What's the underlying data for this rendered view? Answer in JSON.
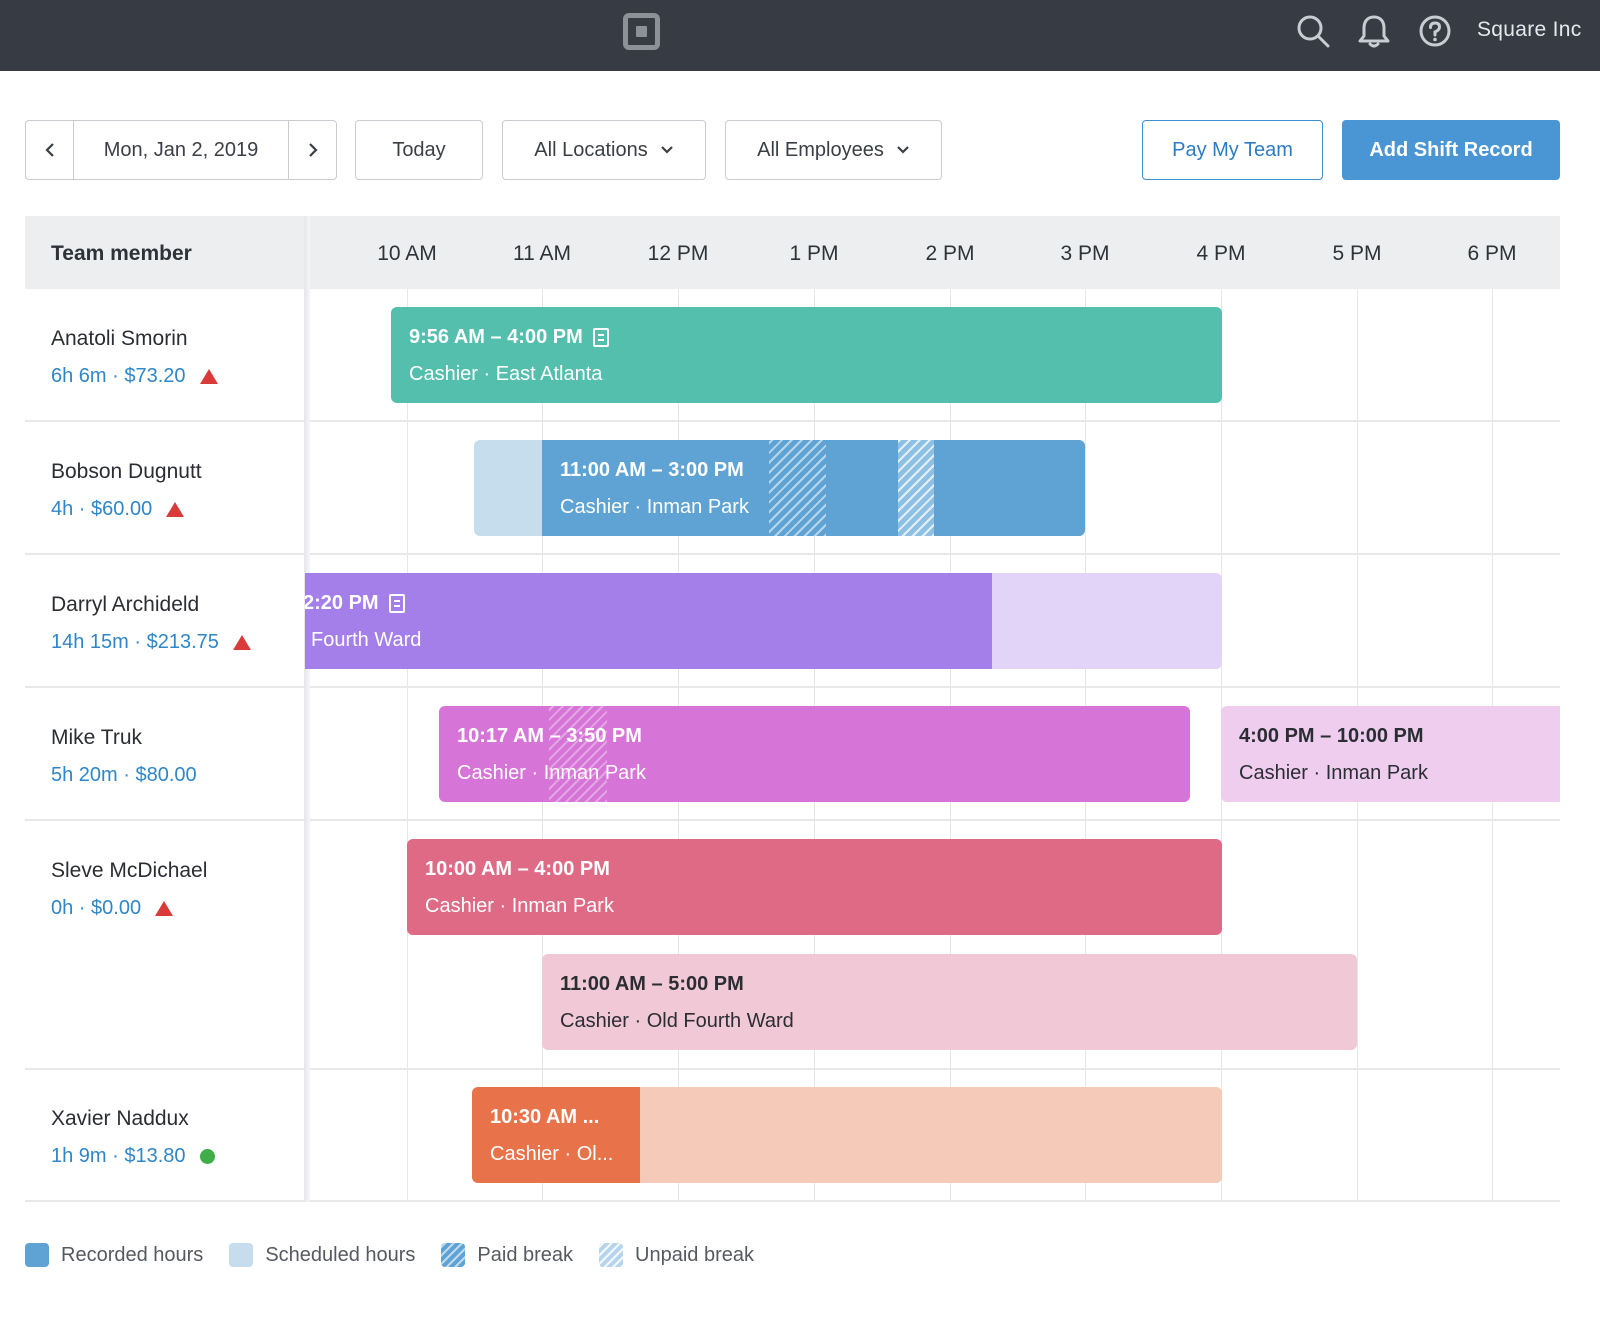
{
  "topbar": {
    "logo_icon": "square-logo-icon",
    "icons": [
      "search-icon",
      "bell-icon",
      "help-icon"
    ],
    "org_name": "Square Inc"
  },
  "toolbar": {
    "prev_icon": "chevron-left-icon",
    "date": "Mon, Jan 2, 2019",
    "next_icon": "chevron-right-icon",
    "today_label": "Today",
    "locations_label": "All Locations",
    "employees_label": "All Employees",
    "pay_team_label": "Pay My Team",
    "add_shift_label": "Add Shift Record"
  },
  "grid": {
    "team_header": "Team member",
    "hours": [
      "10 AM",
      "11 AM",
      "12 PM",
      "1 PM",
      "2 PM",
      "3 PM",
      "4 PM",
      "5 PM",
      "6 PM"
    ]
  },
  "members": [
    {
      "name": "Anatoli Smorin",
      "summary": "6h 6m · $73.20",
      "status": "warning"
    },
    {
      "name": "Bobson Dugnutt",
      "summary": "4h · $60.00",
      "status": "warning"
    },
    {
      "name": "Darryl Archideld",
      "summary": "14h 15m · $213.75",
      "status": "warning"
    },
    {
      "name": "Mike Truk",
      "summary": "5h 20m · $80.00",
      "status": "none"
    },
    {
      "name": "Sleve McDichael",
      "summary": "0h · $0.00",
      "status": "warning"
    },
    {
      "name": "Xavier Naddux",
      "summary": "1h 9m · $13.80",
      "status": "ok"
    }
  ],
  "shifts": [
    {
      "time": "9:56 AM – 4:00 PM",
      "role": "Cashier · East Atlanta",
      "color": "#55bfae",
      "note": true
    },
    {
      "time": "11:00 AM – 3:00 PM",
      "role": "Cashier · Inman Park",
      "color": "#5ea3d4",
      "scheduled_color": "#c6ddee"
    },
    {
      "time": "2:20 PM",
      "role": "Fourth Ward",
      "color": "#a47fe9",
      "scheduled_color": "#e2d4f8",
      "note": true
    },
    {
      "time": "10:17 AM – 3:50 PM",
      "role": "Cashier · Inman Park",
      "color": "#d675d7"
    },
    {
      "time": "4:00 PM – 10:00 PM",
      "role": "Cashier · Inman Park",
      "color": "#efcdef"
    },
    {
      "time": "10:00 AM – 4:00 PM",
      "role": "Cashier · Inman Park",
      "color": "#de6a86"
    },
    {
      "time": "11:00 AM – 5:00 PM",
      "role": "Cashier · Old Fourth Ward",
      "color": "#f1c8d5"
    },
    {
      "time": "10:30 AM ...",
      "role": "Cashier · Ol...",
      "color": "#e8734a",
      "scheduled_color": "#f5cab8"
    }
  ],
  "legend": [
    {
      "label": "Recorded hours",
      "color": "#5ea3d4"
    },
    {
      "label": "Scheduled hours",
      "color": "#c6ddee"
    },
    {
      "label": "Paid break",
      "color": "#5ea3d4"
    },
    {
      "label": "Unpaid break",
      "color": "#b6d4ec"
    }
  ]
}
